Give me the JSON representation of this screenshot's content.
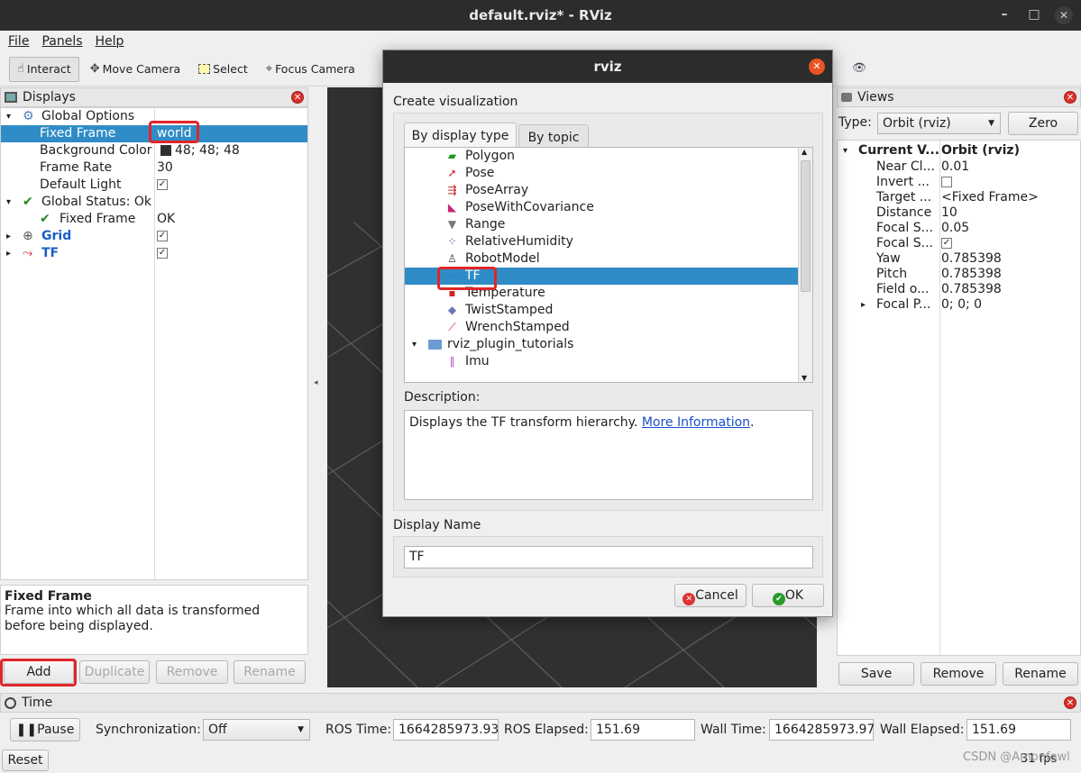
{
  "window": {
    "title": "default.rviz* - RViz",
    "minimize": "–",
    "maximize": "□",
    "close": "✕"
  },
  "menu": {
    "file": "File",
    "panels": "Panels",
    "help": "Help"
  },
  "toolbar": {
    "interact": "Interact",
    "move_camera": "Move Camera",
    "select": "Select",
    "focus_camera": "Focus Camera"
  },
  "displays": {
    "title": "Displays",
    "global_options": "Global Options",
    "fixed_frame_label": "Fixed Frame",
    "fixed_frame_value": "world",
    "bg_color_label": "Background Color",
    "bg_color_value": "48; 48; 48",
    "frame_rate_label": "Frame Rate",
    "frame_rate_value": "30",
    "default_light_label": "Default Light",
    "global_status": "Global Status: Ok",
    "status_fixed_frame": "Fixed Frame",
    "status_fixed_value": "OK",
    "grid": "Grid",
    "tf": "TF",
    "desc_title": "Fixed Frame",
    "desc_text": "Frame into which all data is transformed before being displayed.",
    "add": "Add",
    "duplicate": "Duplicate",
    "remove": "Remove",
    "rename": "Rename"
  },
  "views": {
    "title": "Views",
    "type_label": "Type:",
    "type_value": "Orbit (rviz)",
    "zero": "Zero",
    "header_key": "Current V...",
    "header_val": "Orbit (rviz)",
    "props": [
      {
        "k": "Near Cl...",
        "v": "0.01"
      },
      {
        "k": "Invert ...",
        "v": ""
      },
      {
        "k": "Target ...",
        "v": "<Fixed Frame>"
      },
      {
        "k": "Distance",
        "v": "10"
      },
      {
        "k": "Focal S...",
        "v": "0.05"
      },
      {
        "k": "Focal S...",
        "v": ""
      },
      {
        "k": "Yaw",
        "v": "0.785398"
      },
      {
        "k": "Pitch",
        "v": "0.785398"
      },
      {
        "k": "Field o...",
        "v": "0.785398"
      },
      {
        "k": "Focal P...",
        "v": "0; 0; 0"
      }
    ],
    "save": "Save",
    "remove": "Remove",
    "rename": "Rename"
  },
  "time": {
    "title": "Time",
    "pause": "Pause",
    "sync_label": "Synchronization:",
    "sync_value": "Off",
    "ros_time_label": "ROS Time:",
    "ros_time": "1664285973.93",
    "ros_elapsed_label": "ROS Elapsed:",
    "ros_elapsed": "151.69",
    "wall_time_label": "Wall Time:",
    "wall_time": "1664285973.97",
    "wall_elapsed_label": "Wall Elapsed:",
    "wall_elapsed": "151.69",
    "reset": "Reset",
    "fps": "31 fps",
    "watermark": "CSDN @Amonfowl"
  },
  "dialog": {
    "title": "rviz",
    "create_label": "Create visualization",
    "tab_type": "By display type",
    "tab_topic": "By topic",
    "items": [
      "Polygon",
      "Pose",
      "PoseArray",
      "PoseWithCovariance",
      "Range",
      "RelativeHumidity",
      "RobotModel",
      "TF",
      "Temperature",
      "TwistStamped",
      "WrenchStamped"
    ],
    "plugin_folder": "rviz_plugin_tutorials",
    "plugin_item": "Imu",
    "description_label": "Description:",
    "description_text": "Displays the TF transform hierarchy.",
    "more_info": "More Information",
    "display_name_label": "Display Name",
    "display_name_value": "TF",
    "cancel": "Cancel",
    "ok": "OK"
  }
}
